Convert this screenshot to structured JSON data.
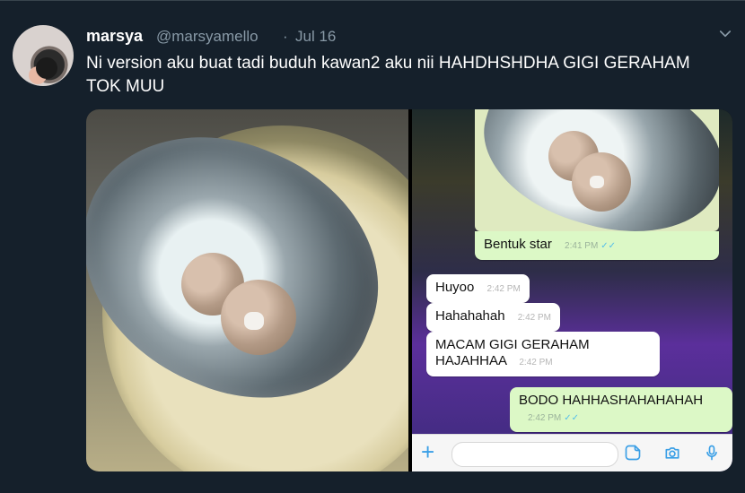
{
  "tweet": {
    "author_name": "marsya",
    "author_handle": "@marsyamello",
    "separator": "·",
    "date": "Jul 16",
    "text": "Ni version aku buat tadi buduh kawan2 aku nii HAHDHSHDHA GIGI GERAHAM TOK MUU"
  },
  "icons": {
    "more": "chevron-down-icon",
    "avatar": "avatar",
    "plus": "plus-icon",
    "sticker": "sticker-icon",
    "camera": "camera-icon",
    "mic": "mic-icon"
  },
  "chat": {
    "messages": [
      {
        "text": "Bentuk star",
        "time": "2:41 PM",
        "direction": "out",
        "ticks": "✓✓"
      },
      {
        "text": "Huyoo",
        "time": "2:42 PM",
        "direction": "in"
      },
      {
        "text": "Hahahahah",
        "time": "2:42 PM",
        "direction": "in"
      },
      {
        "text": "MACAM GIGI GERAHAM HAJAHHAA",
        "time": "2:42 PM",
        "direction": "in"
      },
      {
        "text": "BODO HAHHASHAHAHAHAH",
        "time": "2:42 PM",
        "direction": "out",
        "ticks": "✓✓"
      }
    ],
    "composer_plus": "+"
  },
  "colors": {
    "background": "#15202b",
    "muted_text": "#8899a6",
    "accent": "#1da1f2",
    "wa_out_bubble": "#dcf8c6",
    "wa_in_bubble": "#ffffff"
  }
}
